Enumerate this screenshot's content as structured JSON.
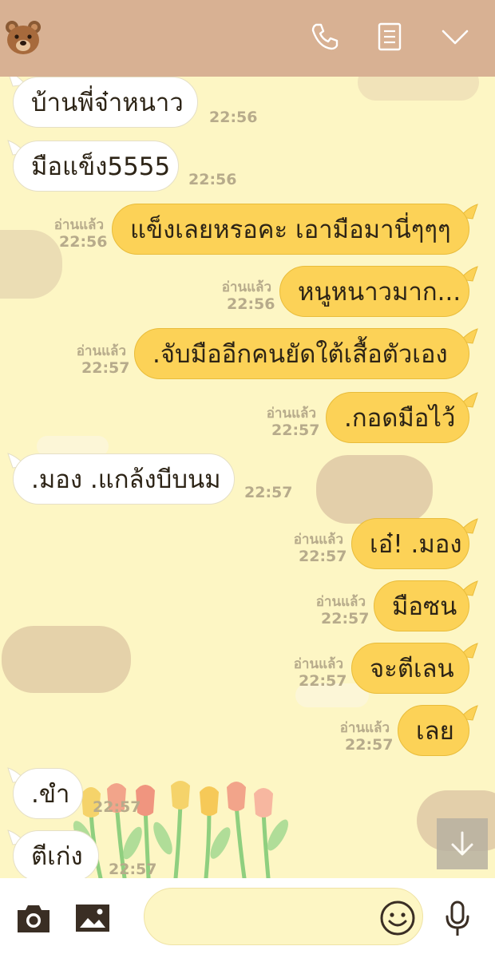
{
  "header": {
    "avatar_icon": "bear-face-icon",
    "call_icon": "phone-icon",
    "notes_icon": "note-icon",
    "menu_icon": "chevron-down-icon",
    "background_color": "#d8b193"
  },
  "colors": {
    "chat_background": "#fdf6c4",
    "incoming_bubble": "#ffffff",
    "outgoing_bubble": "#fcd257"
  },
  "messages": [
    {
      "direction": "in",
      "text": "บ้านพี่จ๋าหนาว",
      "time": "22:56"
    },
    {
      "direction": "in",
      "text": "มือแข็ง5555",
      "time": "22:56"
    },
    {
      "direction": "out",
      "text": "แข็งเลยหรอคะ เอามือมานี่ๆๆๆ",
      "read": "อ่านแล้ว",
      "time": "22:56"
    },
    {
      "direction": "out",
      "text": "หนูหนาวมาก...",
      "read": "อ่านแล้ว",
      "time": "22:56"
    },
    {
      "direction": "out",
      "text": ".จับมืออีกคนยัดใต้เสื้อตัวเอง",
      "read": "อ่านแล้ว",
      "time": "22:57"
    },
    {
      "direction": "out",
      "text": ".กอดมือไว้",
      "read": "อ่านแล้ว",
      "time": "22:57"
    },
    {
      "direction": "in",
      "text": ".มอง .แกล้งบีบนม",
      "time": "22:57"
    },
    {
      "direction": "out",
      "text": "เอ๋! .มอง",
      "read": "อ่านแล้ว",
      "time": "22:57"
    },
    {
      "direction": "out",
      "text": "มือซน",
      "read": "อ่านแล้ว",
      "time": "22:57"
    },
    {
      "direction": "out",
      "text": "จะตีเลน",
      "read": "อ่านแล้ว",
      "time": "22:57"
    },
    {
      "direction": "out",
      "text": "เลย",
      "read": "อ่านแล้ว",
      "time": "22:57"
    },
    {
      "direction": "in",
      "text": ".ขำ",
      "time": "22:57"
    },
    {
      "direction": "in",
      "text": "ตีเก่ง",
      "time": "22:57"
    }
  ],
  "scroll_down_icon": "arrow-down-icon",
  "input_bar": {
    "camera_icon": "camera-icon",
    "gallery_icon": "image-icon",
    "message_value": "",
    "emoji_icon": "smiley-icon",
    "mic_icon": "microphone-icon"
  }
}
